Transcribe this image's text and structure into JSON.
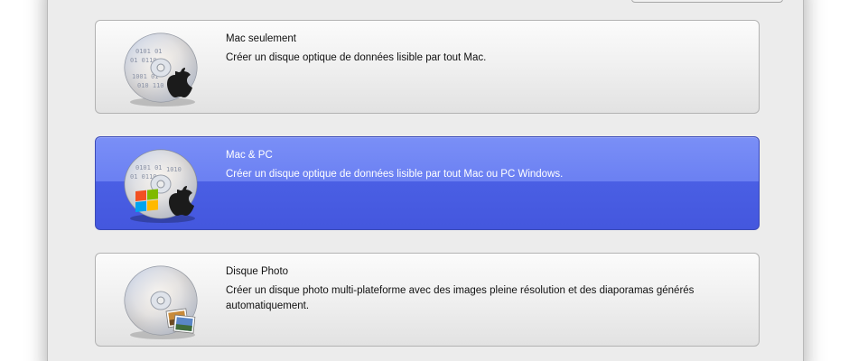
{
  "options": [
    {
      "title": "Mac seulement",
      "description": "Créer un disque optique de données lisible par tout Mac.",
      "icon": "data-disc-apple-icon",
      "selected": false
    },
    {
      "title": "Mac & PC",
      "description": "Créer un disque optique de données lisible par tout Mac ou PC Windows.",
      "icon": "data-disc-mac-pc-icon",
      "selected": true
    },
    {
      "title": "Disque Photo",
      "description": "Créer un disque photo multi-plateforme avec des images pleine résolution et des diaporamas générés automatiquement.",
      "icon": "photo-disc-icon",
      "selected": false
    }
  ],
  "colors": {
    "selection": "#5b6ff0",
    "window_bg": "#ececec"
  }
}
